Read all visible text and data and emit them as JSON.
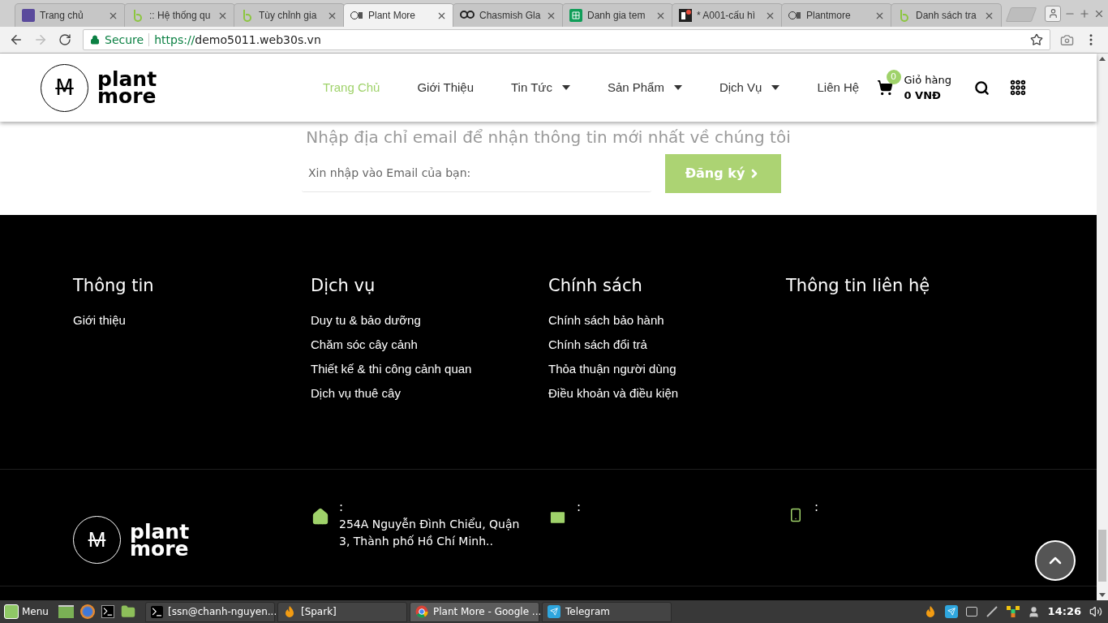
{
  "browser": {
    "tabs": [
      {
        "title": "Trang chủ",
        "kind": "square",
        "selected": false
      },
      {
        "title": ":: Hệ thống qu",
        "kind": "ring",
        "selected": false
      },
      {
        "title": "Tùy chỉnh gia",
        "kind": "ring",
        "selected": false
      },
      {
        "title": "Plant More",
        "kind": "logo",
        "selected": true
      },
      {
        "title": "Chasmish Gla",
        "kind": "glasses",
        "selected": false
      },
      {
        "title": "Danh gia tem",
        "kind": "sheet",
        "selected": false
      },
      {
        "title": "* A001-cấu hì",
        "kind": "badge",
        "selected": false
      },
      {
        "title": "Plantmore",
        "kind": "logo",
        "selected": false
      },
      {
        "title": "Danh sách tra",
        "kind": "ring",
        "selected": false
      }
    ],
    "nav_buttons": [
      {
        "kind": "back",
        "disabled": false
      },
      {
        "kind": "forward",
        "disabled": true
      },
      {
        "kind": "reload",
        "disabled": false
      }
    ],
    "address": {
      "security": "Secure",
      "scheme": "https://",
      "host": "demo5011.web30s.vn"
    }
  },
  "site": {
    "logo": {
      "mark": "M",
      "line1": "plant",
      "line2": "more"
    },
    "nav": [
      {
        "label": "Trang Chủ",
        "selected": true,
        "dropdown": false
      },
      {
        "label": "Giới Thiệu",
        "selected": false,
        "dropdown": false
      },
      {
        "label": "Tin Tức",
        "selected": false,
        "dropdown": true
      },
      {
        "label": "Sản Phẩm",
        "selected": false,
        "dropdown": true
      },
      {
        "label": "Dịch Vụ",
        "selected": false,
        "dropdown": true
      },
      {
        "label": "Liên Hệ",
        "selected": false,
        "dropdown": false
      }
    ],
    "cart": {
      "count": "0",
      "label": "Giỏ hàng",
      "total": "0 VNĐ"
    },
    "newsletter": {
      "heading": "Nhập địa chỉ email để nhận thông tin mới nhất về chúng tôi",
      "placeholder": "Xin nhập vào Email của bạn:",
      "button": "Đăng ký"
    },
    "footer": {
      "columns": [
        {
          "title": "Thông tin",
          "links": [
            "Giới thiệu"
          ]
        },
        {
          "title": "Dịch vụ",
          "links": [
            "Duy tu & bảo dưỡng",
            "Chăm sóc cây cảnh",
            "Thiết kế & thi công cảnh quan",
            "Dịch vụ thuê cây"
          ]
        },
        {
          "title": "Chính sách",
          "links": [
            "Chính sách bảo hành",
            "Chính sách đổi trả",
            "Thỏa thuận người dùng",
            "Điều khoản và điều kiện"
          ]
        },
        {
          "title": "Thông tin liên hệ"
        }
      ],
      "logo": {
        "mark": "M",
        "line1": "plant",
        "line2": "more"
      },
      "contacts": [
        {
          "kind": "address",
          "label": ":",
          "text": "254A Nguyễn Đình Chiểu, Quận 3, Thành phố Hồ Chí Minh.."
        },
        {
          "kind": "email",
          "label": ":"
        },
        {
          "kind": "phone",
          "label": ":"
        }
      ]
    }
  },
  "taskbar": {
    "menu": "Menu",
    "windows": [
      {
        "title": "[ssn@chanh-nguyen...",
        "kind": "terminal",
        "selected": false
      },
      {
        "title": "[Spark]",
        "kind": "spark",
        "selected": false
      },
      {
        "title": "Plant More - Google ...",
        "kind": "chrome",
        "selected": true
      },
      {
        "title": "Telegram",
        "kind": "telegram",
        "selected": false
      }
    ],
    "clock": "14:26"
  }
}
